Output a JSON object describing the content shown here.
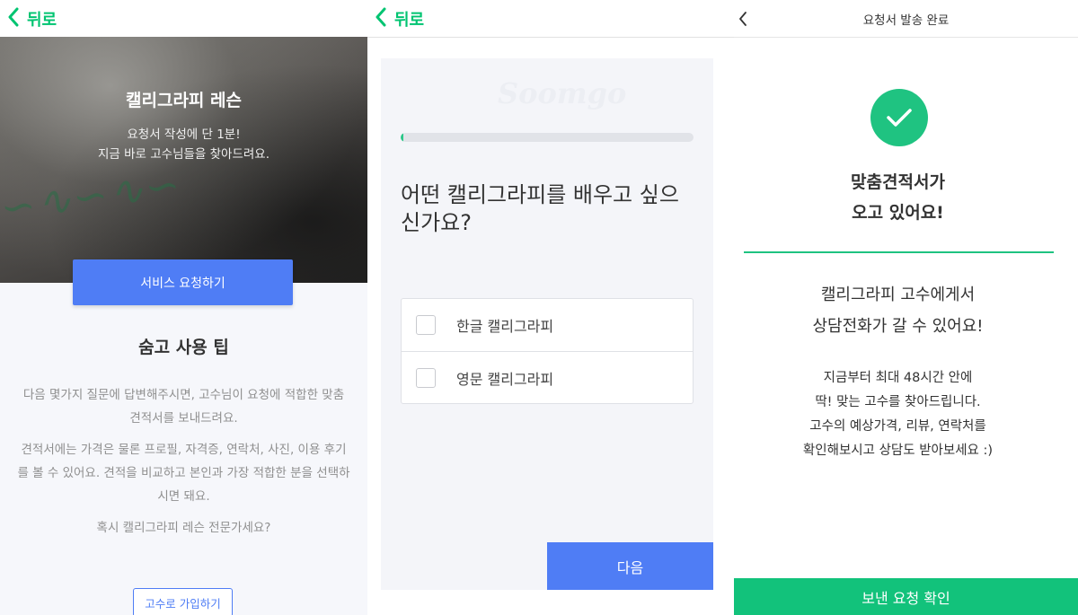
{
  "colors": {
    "accent_green": "#00c471",
    "primary_blue": "#4f7df5",
    "success_green": "#1fc381",
    "bottom_bar_green": "#12c27b"
  },
  "screen1": {
    "back_label": "뒤로",
    "back_icon": "chevron-left-icon",
    "hero_title": "캘리그라피 레슨",
    "hero_sub_line1": "요청서 작성에 단 1분!",
    "hero_sub_line2": "지금 바로 고수님들을 찾아드려요.",
    "request_button": "서비스 요청하기",
    "tips_title": "숨고 사용 팁",
    "tip1": "다음 몇가지 질문에 답변해주시면, 고수님이 요청에 적합한 맞춤 견적서를 보내드려요.",
    "tip2": "견적서에는 가격은 물론 프로필, 자격증, 연락처, 사진, 이용 후기를 볼 수 있어요. 견적을 비교하고 본인과 가장 적합한 분을 선택하시면 돼요.",
    "tip3": "혹시 캘리그라피 레슨 전문가세요?",
    "signup_button": "고수로 가입하기"
  },
  "screen2": {
    "back_label": "뒤로",
    "back_icon": "chevron-left-icon",
    "progress": 0.01,
    "question": "어떤 캘리그라피를 배우고 싶으신가요?",
    "options": [
      {
        "label": "한글 캘리그라피",
        "checked": false
      },
      {
        "label": "영문 캘리그라피",
        "checked": false
      }
    ],
    "next_button": "다음"
  },
  "screen3": {
    "back_icon": "chevron-left-icon",
    "title": "요청서 발송 완료",
    "success_icon": "check-circle-icon",
    "headline_line1": "맞춤견적서가",
    "headline_line2": "오고 있어요!",
    "message_line1": "캘리그라피 고수에게서",
    "message_line2": "상담전화가 갈 수 있어요!",
    "detail_line1": "지금부터 최대 48시간 안에",
    "detail_line2": "딱! 맞는 고수를 찾아드립니다.",
    "detail_line3": "고수의 예상가격, 리뷰, 연락처를",
    "detail_line4": "확인해보시고 상담도 받아보세요 :)",
    "confirm_button": "보낸 요청 확인"
  }
}
